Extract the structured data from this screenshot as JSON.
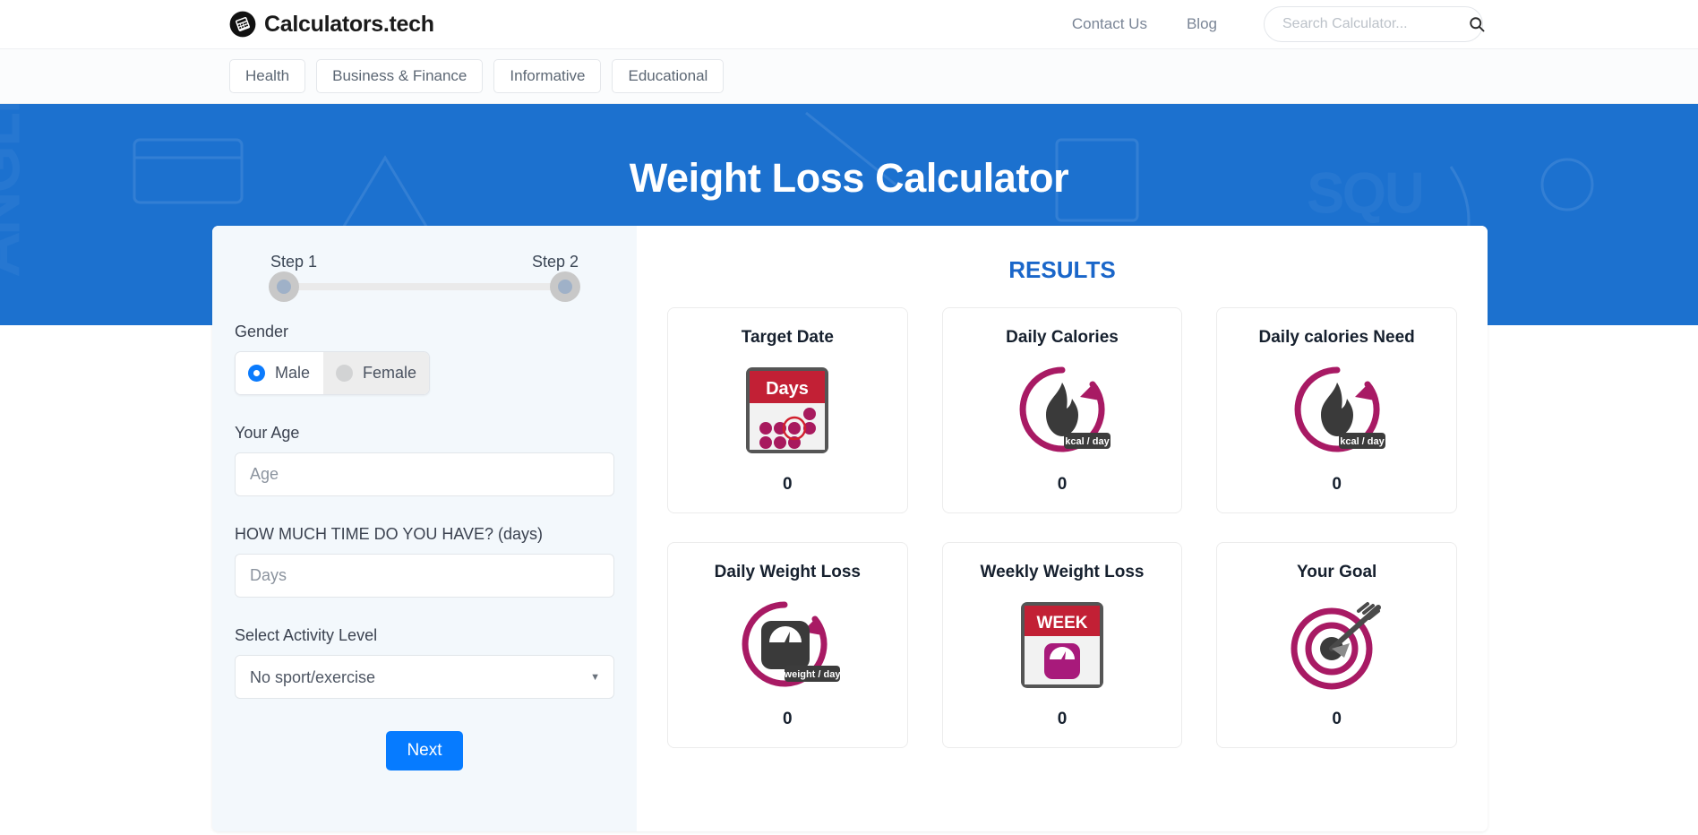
{
  "header": {
    "brand": "Calculators.tech",
    "brand_logo_icon": "calculator-icon",
    "nav": [
      {
        "label": "Contact Us"
      },
      {
        "label": "Blog"
      }
    ],
    "search": {
      "placeholder": "Search Calculator...",
      "value": "",
      "icon": "search-icon"
    }
  },
  "categories": [
    {
      "label": "Health"
    },
    {
      "label": "Business & Finance"
    },
    {
      "label": "Informative"
    },
    {
      "label": "Educational"
    }
  ],
  "hero": {
    "title": "Weight Loss Calculator",
    "background_color": "#1c71cf"
  },
  "form": {
    "steps": [
      {
        "label": "Step 1"
      },
      {
        "label": "Step 2"
      }
    ],
    "gender": {
      "label": "Gender",
      "options": [
        {
          "label": "Male",
          "selected": true
        },
        {
          "label": "Female",
          "selected": false
        }
      ]
    },
    "age": {
      "label": "Your Age",
      "placeholder": "Age",
      "value": ""
    },
    "days": {
      "label": "HOW MUCH TIME DO YOU HAVE? (days)",
      "placeholder": "Days",
      "value": ""
    },
    "activity": {
      "label": "Select Activity Level",
      "selected": "No sport/exercise",
      "caret_icon": "chevron-down-icon"
    },
    "next_button": "Next",
    "next_button_color": "#067bff"
  },
  "results": {
    "title": "RESULTS",
    "title_color": "#1a66c9",
    "accent_color": "#a81a64",
    "cards": [
      {
        "title": "Target Date",
        "value": "0",
        "icon": "calendar-days-icon",
        "badge": "Days"
      },
      {
        "title": "Daily Calories",
        "value": "0",
        "icon": "flame-kcal-icon",
        "badge": "kcal / day"
      },
      {
        "title": "Daily calories Need",
        "value": "0",
        "icon": "flame-kcal-icon",
        "badge": "kcal / day"
      },
      {
        "title": "Daily Weight Loss",
        "value": "0",
        "icon": "weight-scale-icon",
        "badge": "weight / day"
      },
      {
        "title": "Weekly Weight Loss",
        "value": "0",
        "icon": "calendar-week-scale-icon",
        "badge": "WEEK"
      },
      {
        "title": "Your Goal",
        "value": "0",
        "icon": "target-arrow-icon",
        "badge": ""
      }
    ]
  }
}
